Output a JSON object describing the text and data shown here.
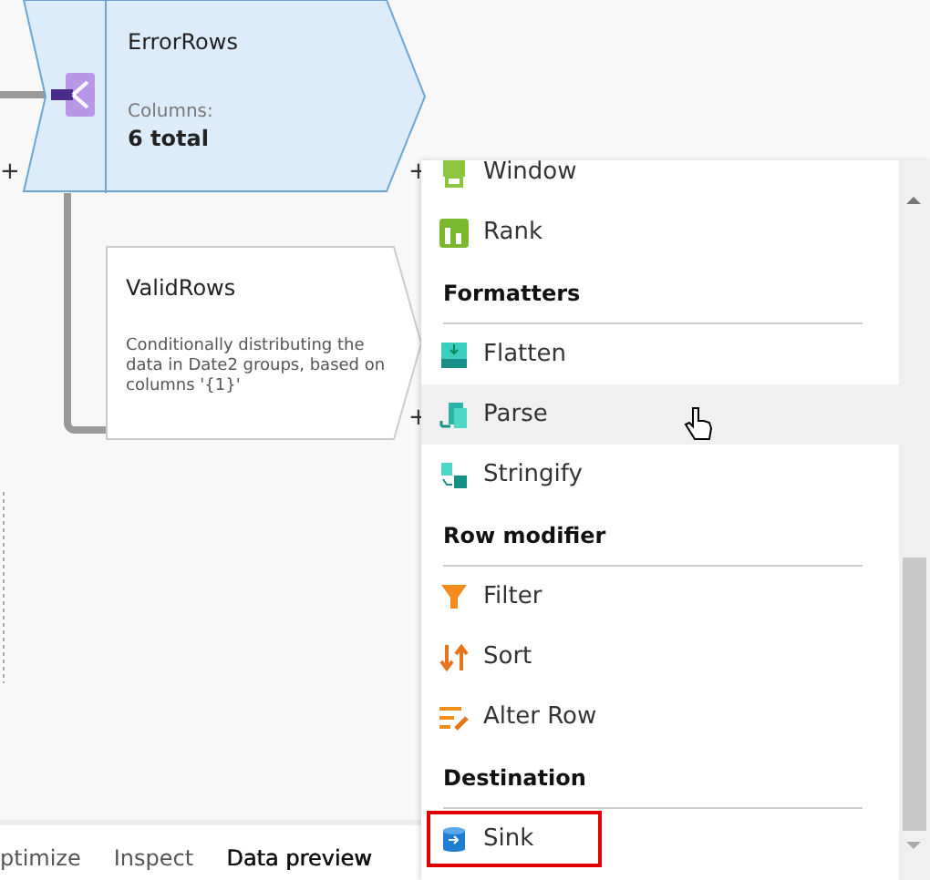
{
  "nodes": [
    {
      "kind": "split",
      "title": "ErrorRows",
      "label": "Columns:",
      "value": "6 total",
      "selected": true
    },
    {
      "kind": "plain",
      "title": "ValidRows",
      "description": "Conditionally distributing the data in Date2 groups, based on columns '{1}'",
      "selected": false
    }
  ],
  "menu": [
    {
      "kind": "item",
      "label": "Window",
      "hovered": false,
      "outlined": false
    },
    {
      "kind": "item",
      "label": "Rank",
      "hovered": false,
      "outlined": false
    },
    {
      "kind": "header",
      "label": "Formatters"
    },
    {
      "kind": "item",
      "label": "Flatten",
      "hovered": false,
      "outlined": false
    },
    {
      "kind": "item",
      "label": "Parse",
      "hovered": true,
      "outlined": false
    },
    {
      "kind": "item",
      "label": "Stringify",
      "hovered": false,
      "outlined": false
    },
    {
      "kind": "header",
      "label": "Row modifier"
    },
    {
      "kind": "item",
      "label": "Filter",
      "hovered": false,
      "outlined": false
    },
    {
      "kind": "item",
      "label": "Sort",
      "hovered": false,
      "outlined": false
    },
    {
      "kind": "item",
      "label": "Alter Row",
      "hovered": false,
      "outlined": false
    },
    {
      "kind": "header",
      "label": "Destination"
    },
    {
      "kind": "item",
      "label": "Sink",
      "hovered": false,
      "outlined": true
    }
  ],
  "ports": [
    "+",
    "+",
    "+"
  ],
  "tabs": [
    {
      "label": "ptimize",
      "selected": false
    },
    {
      "label": "Inspect",
      "selected": false
    },
    {
      "label": "Data preview",
      "selected": true
    }
  ]
}
